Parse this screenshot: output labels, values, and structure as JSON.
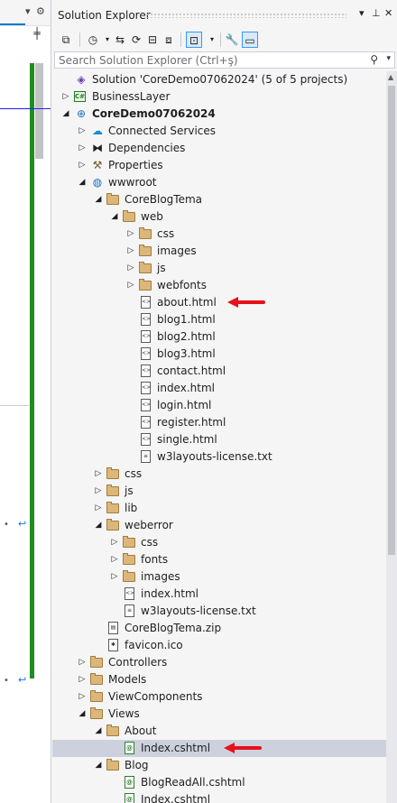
{
  "panel": {
    "title": "Solution Explorer",
    "controls": {
      "dropdown": "▾",
      "pin": "⊥",
      "close": "✕"
    },
    "search": {
      "placeholder": "Search Solution Explorer (Ctrl+ş)"
    }
  },
  "left_pane": {
    "gear": "⚙",
    "split_button": "╪"
  },
  "tree": [
    {
      "label": "Solution 'CoreDemo07062024' (5 of 5 projects)",
      "icon": "solution-icon",
      "toggle": "none",
      "indent": 0
    },
    {
      "label": "BusinessLayer",
      "icon": "csharp-project-icon",
      "toggle": "collapsed",
      "indent": 0
    },
    {
      "label": "CoreDemo07062024",
      "icon": "web-project-icon",
      "toggle": "expanded",
      "indent": 0,
      "bold": true
    },
    {
      "label": "Connected Services",
      "icon": "connected-services-icon",
      "toggle": "collapsed",
      "indent": 1
    },
    {
      "label": "Dependencies",
      "icon": "dependencies-icon",
      "toggle": "collapsed",
      "indent": 1
    },
    {
      "label": "Properties",
      "icon": "properties-icon",
      "toggle": "collapsed",
      "indent": 1
    },
    {
      "label": "wwwroot",
      "icon": "globe-icon",
      "toggle": "expanded",
      "indent": 1
    },
    {
      "label": "CoreBlogTema",
      "icon": "folder-icon",
      "toggle": "expanded",
      "indent": 2
    },
    {
      "label": "web",
      "icon": "folder-icon",
      "toggle": "expanded",
      "indent": 3
    },
    {
      "label": "css",
      "icon": "folder-icon",
      "toggle": "collapsed",
      "indent": 4
    },
    {
      "label": "images",
      "icon": "folder-icon",
      "toggle": "collapsed",
      "indent": 4
    },
    {
      "label": "js",
      "icon": "folder-icon",
      "toggle": "collapsed",
      "indent": 4
    },
    {
      "label": "webfonts",
      "icon": "folder-icon",
      "toggle": "collapsed",
      "indent": 4
    },
    {
      "label": "about.html",
      "icon": "html-file-icon",
      "toggle": "none",
      "indent": 4,
      "arrow": true
    },
    {
      "label": "blog1.html",
      "icon": "html-file-icon",
      "toggle": "none",
      "indent": 4
    },
    {
      "label": "blog2.html",
      "icon": "html-file-icon",
      "toggle": "none",
      "indent": 4
    },
    {
      "label": "blog3.html",
      "icon": "html-file-icon",
      "toggle": "none",
      "indent": 4
    },
    {
      "label": "contact.html",
      "icon": "html-file-icon",
      "toggle": "none",
      "indent": 4
    },
    {
      "label": "index.html",
      "icon": "html-file-icon",
      "toggle": "none",
      "indent": 4
    },
    {
      "label": "login.html",
      "icon": "html-file-icon",
      "toggle": "none",
      "indent": 4
    },
    {
      "label": "register.html",
      "icon": "html-file-icon",
      "toggle": "none",
      "indent": 4
    },
    {
      "label": "single.html",
      "icon": "html-file-icon",
      "toggle": "none",
      "indent": 4
    },
    {
      "label": "w3layouts-license.txt",
      "icon": "text-file-icon",
      "toggle": "none",
      "indent": 4
    },
    {
      "label": "css",
      "icon": "folder-icon",
      "toggle": "collapsed",
      "indent": 2
    },
    {
      "label": "js",
      "icon": "folder-icon",
      "toggle": "collapsed",
      "indent": 2
    },
    {
      "label": "lib",
      "icon": "folder-icon",
      "toggle": "collapsed",
      "indent": 2
    },
    {
      "label": "weberror",
      "icon": "folder-icon",
      "toggle": "expanded",
      "indent": 2
    },
    {
      "label": "css",
      "icon": "folder-icon",
      "toggle": "collapsed",
      "indent": 3
    },
    {
      "label": "fonts",
      "icon": "folder-icon",
      "toggle": "collapsed",
      "indent": 3
    },
    {
      "label": "images",
      "icon": "folder-icon",
      "toggle": "collapsed",
      "indent": 3
    },
    {
      "label": "index.html",
      "icon": "html-file-icon",
      "toggle": "none",
      "indent": 3
    },
    {
      "label": "w3layouts-license.txt",
      "icon": "text-file-icon",
      "toggle": "none",
      "indent": 3
    },
    {
      "label": "CoreBlogTema.zip",
      "icon": "zip-file-icon",
      "toggle": "none",
      "indent": 2
    },
    {
      "label": "favicon.ico",
      "icon": "ico-file-icon",
      "toggle": "none",
      "indent": 2
    },
    {
      "label": "Controllers",
      "icon": "folder-icon",
      "toggle": "collapsed",
      "indent": 1
    },
    {
      "label": "Models",
      "icon": "folder-icon",
      "toggle": "collapsed",
      "indent": 1
    },
    {
      "label": "ViewComponents",
      "icon": "folder-icon",
      "toggle": "collapsed",
      "indent": 1
    },
    {
      "label": "Views",
      "icon": "folder-icon",
      "toggle": "expanded",
      "indent": 1
    },
    {
      "label": "About",
      "icon": "folder-icon",
      "toggle": "expanded",
      "indent": 2
    },
    {
      "label": "Index.cshtml",
      "icon": "razor-file-icon",
      "toggle": "none",
      "indent": 3,
      "selected": true,
      "arrow": true
    },
    {
      "label": "Blog",
      "icon": "folder-icon",
      "toggle": "expanded",
      "indent": 2
    },
    {
      "label": "BlogReadAll.cshtml",
      "icon": "razor-file-icon",
      "toggle": "none",
      "indent": 3
    },
    {
      "label": "Index.cshtml",
      "icon": "razor-file-icon",
      "toggle": "none",
      "indent": 3
    }
  ]
}
